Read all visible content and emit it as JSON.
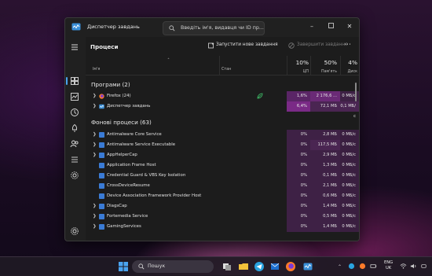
{
  "window": {
    "title": "Диспетчер завдань",
    "search_placeholder": "Введіть ім'я, видавця чи ID пр..."
  },
  "toolbar": {
    "page_title": "Процеси",
    "run_task_label": "Запустити нове завдання",
    "end_task_label": "Завершити завдання"
  },
  "columns": {
    "name": "Ім'я",
    "status": "Стан",
    "cpu_pct": "10%",
    "cpu_label": "ЦП",
    "mem_pct": "50%",
    "mem_label": "Пам'ять",
    "disk_pct": "4%",
    "disk_label": "Диск"
  },
  "groups": {
    "apps_title": "Програми (2)",
    "bg_title": "Фонові процеси (63)"
  },
  "apps": [
    {
      "name": "Firefox (24)",
      "icon": "firefox-icon",
      "cpu": "1,6%",
      "mem": "2 176,6 ...",
      "disk": "0 МБ/с",
      "status_icon": "eco-leaf-icon"
    },
    {
      "name": "Диспетчер завдань",
      "icon": "task-manager-icon",
      "cpu": "6,4%",
      "mem": "72,1 МБ",
      "disk": "0,1 МБ/с"
    }
  ],
  "background": [
    {
      "name": "Antimalware Core Service",
      "expand": true,
      "cpu": "0%",
      "mem": "2,8 МБ",
      "disk": "0 МБ/с"
    },
    {
      "name": "Antimalware Service Executable",
      "expand": true,
      "cpu": "0%",
      "mem": "117,5 МБ",
      "disk": "0 МБ/с"
    },
    {
      "name": "AppHelperCap",
      "expand": true,
      "cpu": "0%",
      "mem": "2,9 МБ",
      "disk": "0 МБ/с"
    },
    {
      "name": "Application Frame Host",
      "expand": false,
      "cpu": "0%",
      "mem": "1,3 МБ",
      "disk": "0 МБ/с"
    },
    {
      "name": "Credential Guard & VBS Key Isolation",
      "expand": false,
      "cpu": "0%",
      "mem": "0,1 МБ",
      "disk": "0 МБ/с"
    },
    {
      "name": "CrossDeviceResume",
      "expand": false,
      "cpu": "0%",
      "mem": "2,1 МБ",
      "disk": "0 МБ/с"
    },
    {
      "name": "Device Association Framework Provider Host",
      "expand": false,
      "cpu": "0%",
      "mem": "0,6 МБ",
      "disk": "0 МБ/с"
    },
    {
      "name": "DiagsCap",
      "expand": true,
      "cpu": "0%",
      "mem": "1,4 МБ",
      "disk": "0 МБ/с"
    },
    {
      "name": "Fortemedia Service",
      "expand": true,
      "cpu": "0%",
      "mem": "0,5 МБ",
      "disk": "0 МБ/с"
    },
    {
      "name": "GamingServices",
      "expand": true,
      "cpu": "0%",
      "mem": "1,4 МБ",
      "disk": "0 МБ/с"
    }
  ],
  "taskbar": {
    "search_label": "Пошук",
    "lang": "ENG",
    "lang_region": "UK"
  },
  "colors": {
    "accent": "#4aa3f0",
    "cpu_heat_high": "#7a2a86",
    "cpu_heat_low": "#3e2145",
    "mem_heat": "#4a2552"
  }
}
